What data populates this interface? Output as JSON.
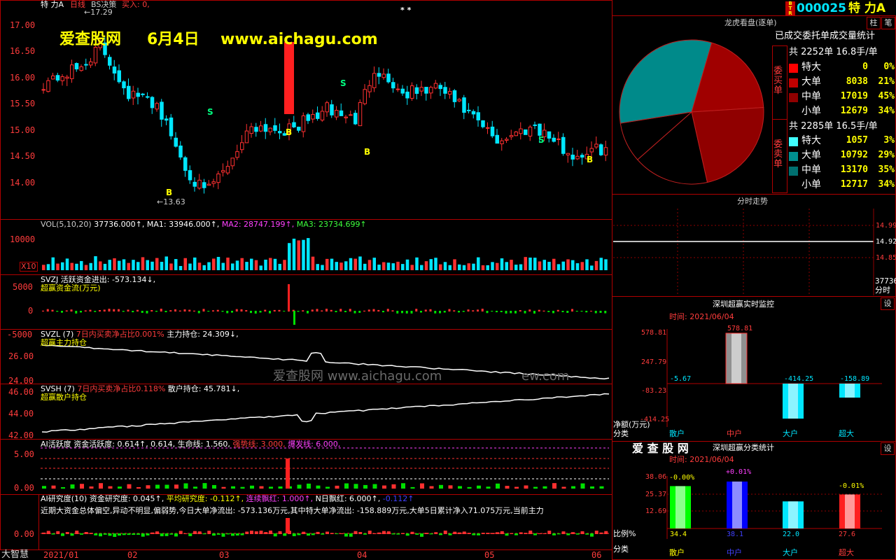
{
  "header": {
    "stock_name": "特 力A",
    "period": "日线",
    "strategy": "BS决策",
    "buy_label": "买入: 0,",
    "high_mark": "17.29",
    "low_mark": "13.63",
    "stars": "* *",
    "code": "000025",
    "code_name": "特 力A",
    "btn_pin": "柱",
    "btn_note": "笔"
  },
  "watermark": {
    "site": "爱查股网",
    "date": "6月4日",
    "url": "www.aichagu.com",
    "url2": "爱查股网     www.aichagu.com",
    "url3": "ew.com"
  },
  "price_axis": [
    "17.00",
    "16.50",
    "16.00",
    "15.50",
    "15.00",
    "14.50",
    "14.00"
  ],
  "signals": {
    "b": "B",
    "s": "S"
  },
  "vol": {
    "title": "VOL(5,10,20)",
    "value": "37736.000↑,",
    "ma1": "MA1: 33946.000↑,",
    "ma2": "MA2: 28747.199↑,",
    "ma3": "MA3: 23734.699↑",
    "axis": "10000",
    "unit": "X10"
  },
  "svzj": {
    "title": "SVZJ",
    "line": "活跃资金进出: -573.134↓,",
    "sub": "超赢资金流(万元)",
    "axis": [
      "5000",
      "0",
      "-5000"
    ]
  },
  "svzl": {
    "title": "SVZL (7)",
    "ratio": "7日内买卖净占比0.001%",
    "hold": "主力持仓: 24.309↓,",
    "sub": "超赢主力持仓",
    "axis": [
      "26.00",
      "24.00"
    ]
  },
  "svsh": {
    "title": "SVSH (7)",
    "ratio": "7日内买卖净占比0.118%",
    "hold": "散户持仓: 45.781↓,",
    "sub": "超赢散户持仓",
    "axis": [
      "46.00",
      "44.00",
      "42.00"
    ]
  },
  "ai_active": {
    "title": "AI活跃度",
    "line1": "资金活跃度: 0.614↑, 0.614,",
    "life": "生命线: 1.560,",
    "strong": "强势线: 3.000,",
    "burst": "爆发线: 6.000,",
    "axis": [
      "5.00",
      "0.00"
    ]
  },
  "ai_research": {
    "title": "AI研究度(10)",
    "line1": "资金研究度: 0.045↑,",
    "avg": "平均研究度: -0.112↑,",
    "red": "连续飘红: 1.000↑,",
    "nday": "N日飘红: 6.000↑,",
    "last": "-0.112↑",
    "desc": "近期大资金总体偏空,异动不明显,偏弱势,今日大单净流出: -573.136万元,其中特大单净流出: -158.889万元,大单5日累计净入71.075万元,当前主力",
    "axis": [
      "0.00"
    ]
  },
  "bottom": {
    "brand": "大智慧",
    "dates": [
      "2021/01",
      "02",
      "03",
      "04",
      "05",
      "06"
    ]
  },
  "dragon": {
    "title": "龙虎看盘(逐单)",
    "subtitle": "已成交委托单成交量统计",
    "buy_label": "委买单",
    "sell_label": "委卖单",
    "buy_total": "共 2252单 16.8手/单",
    "sell_total": "共 2285单 16.5手/单",
    "buy_rows": [
      {
        "name": "特大",
        "count": "0",
        "pct": "0%",
        "color": "#ff0000"
      },
      {
        "name": "大单",
        "count": "8038",
        "pct": "21%",
        "color": "#c00000"
      },
      {
        "name": "中单",
        "count": "17019",
        "pct": "45%",
        "color": "#900000"
      },
      {
        "name": "小单",
        "count": "12679",
        "pct": "34%",
        "color": "#000000"
      }
    ],
    "sell_rows": [
      {
        "name": "特大",
        "count": "1057",
        "pct": "3%",
        "color": "#40ffff"
      },
      {
        "name": "大单",
        "count": "10792",
        "pct": "29%",
        "color": "#009090"
      },
      {
        "name": "中单",
        "count": "13170",
        "pct": "35%",
        "color": "#007070"
      },
      {
        "name": "小单",
        "count": "12717",
        "pct": "34%",
        "color": "#000000"
      }
    ]
  },
  "intraday": {
    "title": "分时走势",
    "axis": [
      "14.99",
      "14.92",
      "14.85"
    ],
    "vol": "37736",
    "vol_unit": "分时"
  },
  "monitor": {
    "title": "深圳超赢实时监控",
    "btn": "设",
    "time": "时间: 2021/06/04",
    "axis": [
      "578.81",
      "247.79",
      "-83.23",
      "-414.25"
    ],
    "unit": "净额(万元)",
    "cat_label": "分类",
    "cats": [
      "散户",
      "中户",
      "大户",
      "超大"
    ],
    "values": [
      "-5.67",
      "578.81",
      "-414.25",
      "-158.89"
    ]
  },
  "classify": {
    "brand": "爱 查 股 网",
    "title": "深圳超赢分类统计",
    "btn": "设",
    "time": "时间: 2021/06/04",
    "axis": [
      "38.06",
      "25.37",
      "12.69"
    ],
    "ratio_label": "比例%",
    "cat_label": "分类",
    "cats": [
      "散户",
      "中户",
      "大户",
      "超大"
    ],
    "changes": [
      "-0.00%",
      "+0.01%",
      "",
      "-0.01%"
    ],
    "values": [
      "34.4",
      "38.1",
      "22.0",
      "27.6"
    ]
  }
}
